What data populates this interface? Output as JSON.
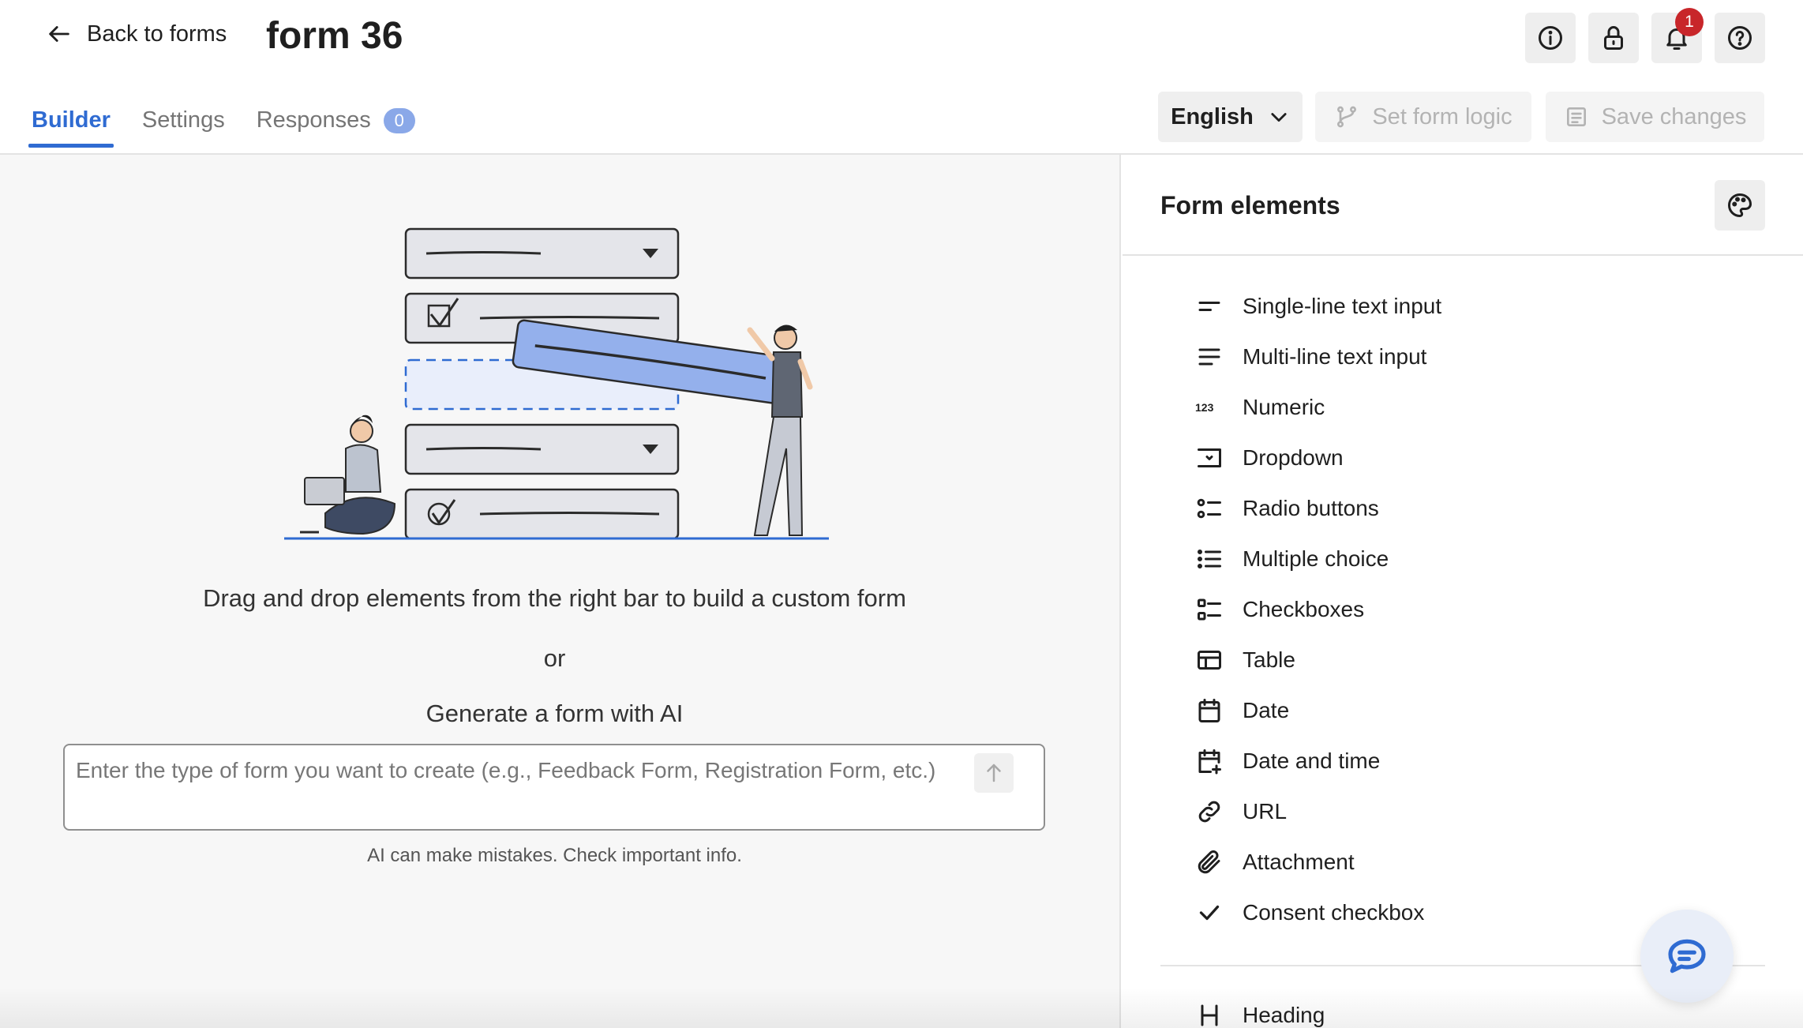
{
  "header": {
    "back_label": "Back to forms",
    "form_title": "form 36",
    "notification_count": "1",
    "tabs": [
      {
        "label": "Builder",
        "active": true
      },
      {
        "label": "Settings",
        "active": false
      },
      {
        "label": "Responses",
        "active": false,
        "count": "0"
      }
    ],
    "language": "English",
    "set_logic_label": "Set form logic",
    "save_label": "Save changes",
    "icons": [
      "info-icon",
      "lock-icon",
      "bell-icon",
      "help-icon"
    ]
  },
  "builder": {
    "drag_text": "Drag and drop elements from the right bar to build a custom form",
    "or_text": "or",
    "generate_text": "Generate a form with AI",
    "ai_placeholder": "Enter the type of form you want to create (e.g., Feedback Form, Registration Form, etc.)",
    "ai_note": "AI can make mistakes. Check important info."
  },
  "panel": {
    "title": "Form elements",
    "elements": [
      {
        "label": "Single-line text input",
        "icon": "short-text-icon"
      },
      {
        "label": "Multi-line text input",
        "icon": "long-text-icon"
      },
      {
        "label": "Numeric",
        "icon": "numeric-icon"
      },
      {
        "label": "Dropdown",
        "icon": "dropdown-icon"
      },
      {
        "label": "Radio buttons",
        "icon": "radio-list-icon"
      },
      {
        "label": "Multiple choice",
        "icon": "bullet-list-icon"
      },
      {
        "label": "Checkboxes",
        "icon": "checkbox-list-icon"
      },
      {
        "label": "Table",
        "icon": "table-icon"
      },
      {
        "label": "Date",
        "icon": "calendar-icon"
      },
      {
        "label": "Date and time",
        "icon": "calendar-plus-icon"
      },
      {
        "label": "URL",
        "icon": "link-icon"
      },
      {
        "label": "Attachment",
        "icon": "paperclip-icon"
      },
      {
        "label": "Consent checkbox",
        "icon": "checkmark-icon"
      }
    ],
    "heading_label": "Heading"
  },
  "colors": {
    "accent": "#2f6bd2",
    "badge": "#c8262a",
    "pill": "#8aa8e8",
    "illustration_blue": "#94b0ec"
  }
}
